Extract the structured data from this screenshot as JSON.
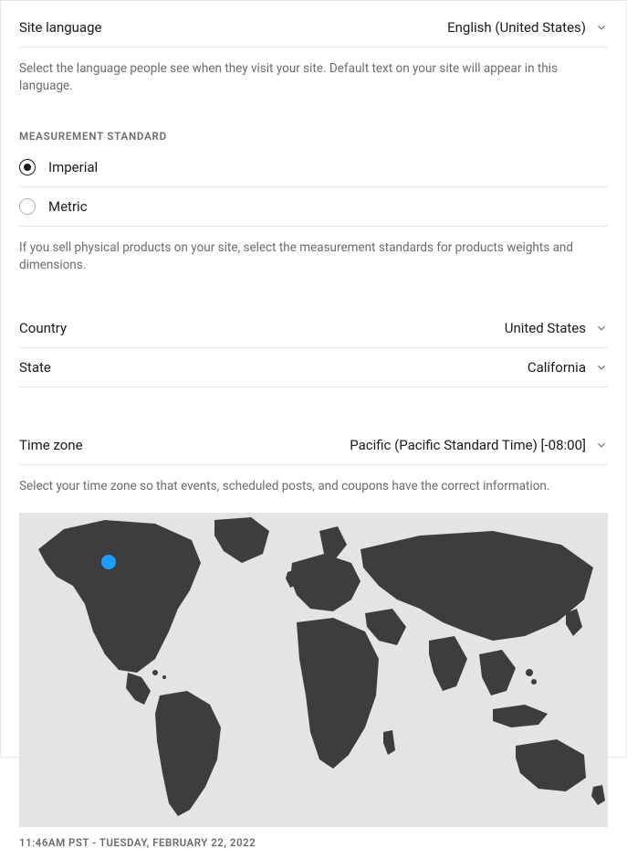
{
  "siteLanguage": {
    "label": "Site language",
    "value": "English (United States)",
    "help": "Select the language people see when they visit your site. Default text on your site will appear in this language."
  },
  "measurement": {
    "header": "Measurement Standard",
    "options": {
      "imperial": "Imperial",
      "metric": "Metric"
    },
    "selected": "imperial",
    "help": "If you sell physical products on your site, select the measurement standards for products weights and dimensions."
  },
  "country": {
    "label": "Country",
    "value": "United States"
  },
  "state": {
    "label": "State",
    "value": "California"
  },
  "timezone": {
    "label": "Time zone",
    "value": "Pacific (Pacific Standard Time) [-08:00]",
    "help": "Select your time zone so that events, scheduled posts, and coupons have the correct information."
  },
  "timestamp": "11:46AM PST - Tuesday, February 22, 2022"
}
